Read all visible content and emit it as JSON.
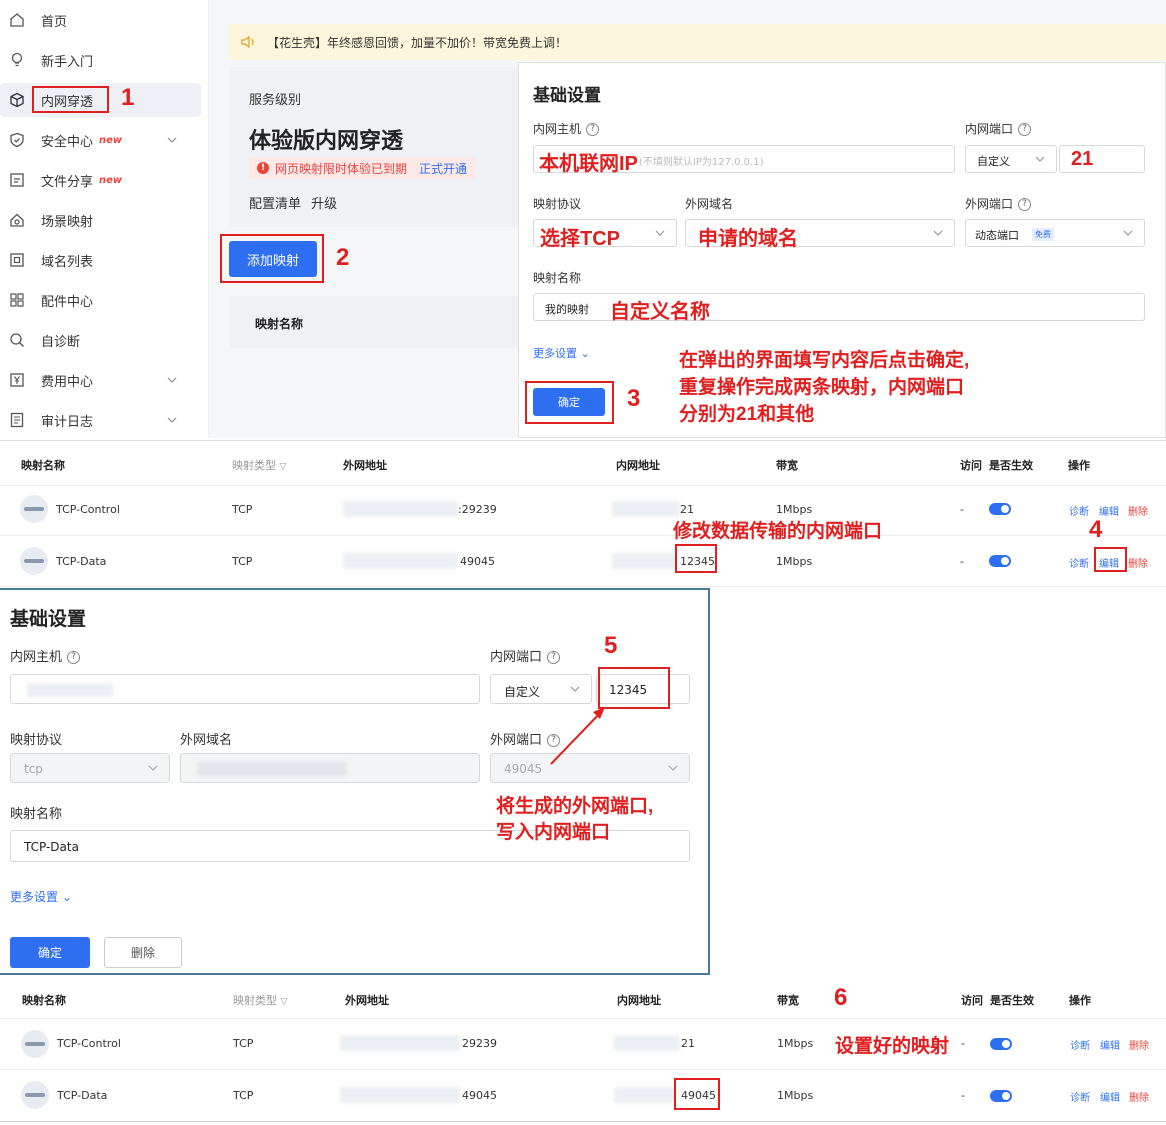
{
  "sidebar": {
    "items": [
      {
        "label": "首页",
        "icon": "home-icon"
      },
      {
        "label": "新手入门",
        "icon": "lightbulb-icon"
      },
      {
        "label": "内网穿透",
        "icon": "cube-icon"
      },
      {
        "label": "安全中心",
        "icon": "shield-icon",
        "badge": "new"
      },
      {
        "label": "文件分享",
        "icon": "file-share-icon",
        "badge": "new"
      },
      {
        "label": "场景映射",
        "icon": "scene-icon"
      },
      {
        "label": "域名列表",
        "icon": "domain-icon"
      },
      {
        "label": "配件中心",
        "icon": "grid-icon"
      },
      {
        "label": "自诊断",
        "icon": "diagnose-icon"
      },
      {
        "label": "费用中心",
        "icon": "yen-icon"
      },
      {
        "label": "审计日志",
        "icon": "log-icon"
      }
    ]
  },
  "notice": {
    "text": "【花生壳】年终感恩回馈，加量不加价！带宽免费上调！"
  },
  "service": {
    "level_label": "服务级别",
    "plan_name": "体验版内网穿透",
    "expired_text": "网页映射限时体验已到期",
    "open_link": "正式开通",
    "config_label": "配置清单",
    "upgrade_label": "升级"
  },
  "add_mapping_button": "添加映射",
  "mapping_name_header": "映射名称",
  "dialog1": {
    "title": "基础设置",
    "host_label": "内网主机",
    "host_placeholder": "(不填则默认IP为127.0.0.1)",
    "port_label": "内网端口",
    "port_mode": "自定义",
    "protocol_label": "映射协议",
    "domain_label": "外网域名",
    "ext_port_label": "外网端口",
    "ext_port_value": "动态端口",
    "ext_port_badge": "免费",
    "name_label": "映射名称",
    "name_value": "我的映射",
    "more_settings": "更多设置",
    "confirm": "确定"
  },
  "annotations": {
    "n1": "1",
    "n2": "2",
    "n3": "3",
    "n4": "4",
    "n5": "5",
    "n6": "6",
    "host_ip": "本机联网IP",
    "port21": "21",
    "select_tcp": "选择TCP",
    "domain_applied": "申请的域名",
    "custom_name": "自定义名称",
    "instruction_line1": "在弹出的界面填写内容后点击确定,",
    "instruction_line2": "重复操作完成两条映射，内网端口",
    "instruction_line3": "分别为21和其他",
    "modify_port": "修改数据传输的内网端口",
    "ext_to_int_line1": "将生成的外网端口,",
    "ext_to_int_line2": "写入内网端口",
    "done": "设置好的映射"
  },
  "table_headers": {
    "name": "映射名称",
    "type": "映射类型",
    "external": "外网地址",
    "internal": "内网地址",
    "bandwidth": "带宽",
    "access": "访问",
    "enabled": "是否生效",
    "actions": "操作"
  },
  "table1": {
    "rows": [
      {
        "name": "TCP-Control",
        "type": "TCP",
        "ext_port": ":29239",
        "int_port": "21",
        "bandwidth": "1Mbps",
        "access": "-"
      },
      {
        "name": "TCP-Data",
        "type": "TCP",
        "ext_port": "49045",
        "int_port": "12345",
        "bandwidth": "1Mbps",
        "access": "-"
      }
    ]
  },
  "table2": {
    "rows": [
      {
        "name": "TCP-Control",
        "type": "TCP",
        "ext_port": "29239",
        "int_port": "21",
        "bandwidth": "1Mbps",
        "access": "-"
      },
      {
        "name": "TCP-Data",
        "type": "TCP",
        "ext_port": "49045",
        "int_port": "49045",
        "bandwidth": "1Mbps",
        "access": "-"
      }
    ]
  },
  "actions": {
    "diagnose": "诊断",
    "edit": "编辑",
    "delete": "删除"
  },
  "dialog2": {
    "title": "基础设置",
    "host_label": "内网主机",
    "port_label": "内网端口",
    "port_mode": "自定义",
    "port_value": "12345",
    "protocol_label": "映射协议",
    "protocol_value": "tcp",
    "domain_label": "外网域名",
    "ext_port_label": "外网端口",
    "ext_port_value": "49045",
    "name_label": "映射名称",
    "name_value": "TCP-Data",
    "more_settings": "更多设置",
    "confirm": "确定",
    "delete": "删除"
  },
  "colors": {
    "accent": "#2e6ff2",
    "annotation": "#e02020",
    "danger": "#e8453c"
  }
}
